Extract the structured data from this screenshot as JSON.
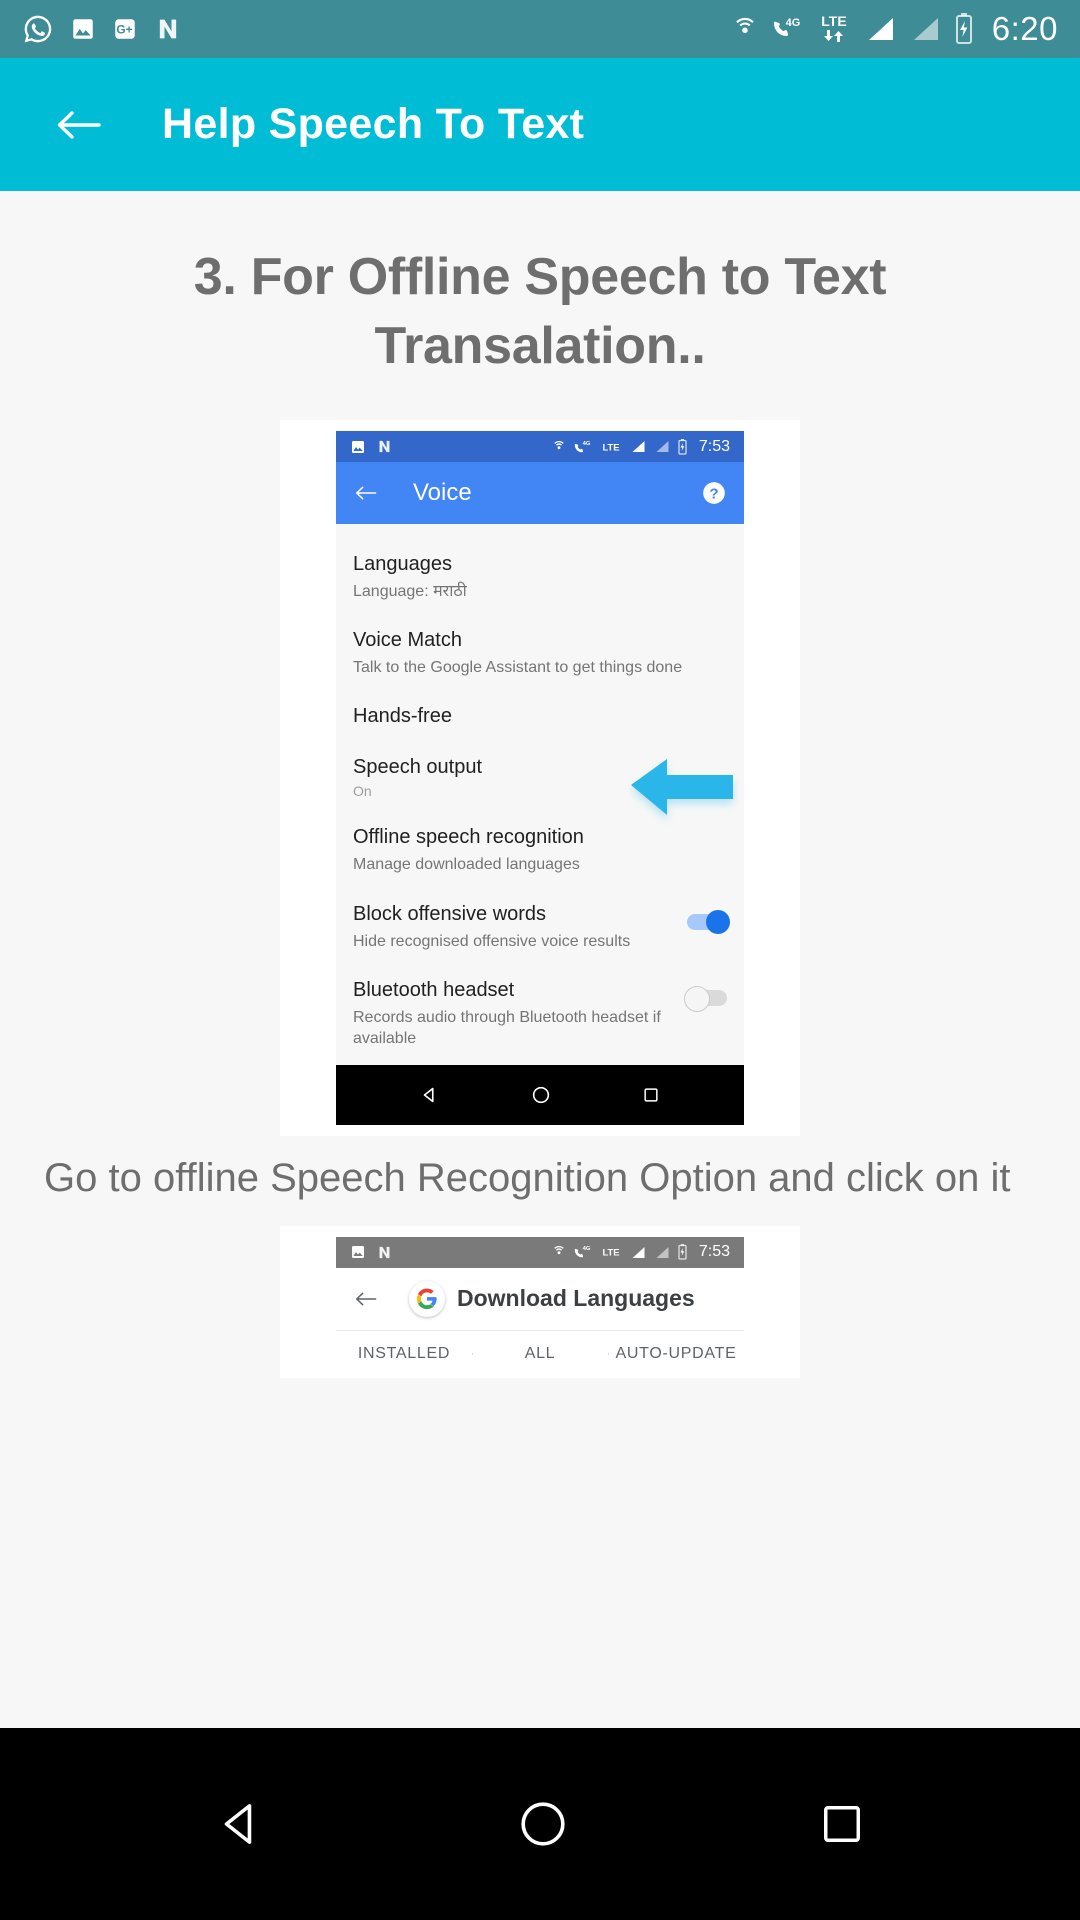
{
  "status_bar": {
    "icons": [
      "whatsapp-icon",
      "photos-icon",
      "google-plus-icon",
      "nova-launcher-icon"
    ],
    "network_icons": [
      "cast-icon",
      "4g-call-icon",
      "lte-data-icon",
      "signal-bar-icon",
      "signal-bar-2-icon",
      "battery-charging-icon"
    ],
    "network_4g_label": "4G",
    "network_lte_label": "LTE",
    "time": "6:20"
  },
  "app_bar": {
    "back_icon": "back-arrow-icon",
    "title": "Help Speech To Text"
  },
  "main": {
    "heading_line1": "3. For Offline Speech to Text",
    "heading_line2": "Transalation..",
    "caption": "Go to offline Speech Recognition Option and click on it"
  },
  "voice_screenshot": {
    "status_bar": {
      "icons": [
        "photos-icon",
        "nova-launcher-icon"
      ],
      "network_4g_label": "4G",
      "network_lte_label": "LTE",
      "time": "7:53"
    },
    "app_bar": {
      "back_icon": "back-arrow-icon",
      "title": "Voice",
      "help_icon": "help-circle-icon"
    },
    "settings": [
      {
        "title": "Languages",
        "subtitle": "Language: मराठी",
        "toggle": null
      },
      {
        "title": "Voice Match",
        "subtitle": "Talk to the Google Assistant to get things done",
        "toggle": null
      },
      {
        "title": "Hands-free",
        "subtitle": "",
        "toggle": null
      },
      {
        "title": "Speech output",
        "subtitle": "On",
        "toggle": null
      },
      {
        "title": "Offline speech recognition",
        "subtitle": "Manage downloaded languages",
        "toggle": null
      },
      {
        "title": "Block offensive words",
        "subtitle": "Hide recognised offensive voice results",
        "toggle": "on"
      },
      {
        "title": "Bluetooth headset",
        "subtitle": "Records audio through Bluetooth headset if available",
        "toggle": "off"
      }
    ],
    "annotation": {
      "icon": "left-pointing-arrow-icon",
      "color": "#29b6e8"
    },
    "nav_bar": {
      "back": "back-triangle-icon",
      "home": "home-circle-icon",
      "recents": "recents-square-icon"
    }
  },
  "download_screenshot": {
    "status_bar": {
      "icons": [
        "photos-icon",
        "nova-launcher-icon"
      ],
      "network_4g_label": "4G",
      "network_lte_label": "LTE",
      "time": "7:53"
    },
    "app_bar": {
      "back_icon": "back-arrow-icon",
      "logo_icon": "google-g-icon",
      "title": "Download Languages"
    },
    "tabs": [
      "INSTALLED",
      "ALL",
      "AUTO-UPDATE"
    ]
  },
  "nav_bar": {
    "back": "back-triangle-icon",
    "home": "home-circle-icon",
    "recents": "recents-square-icon"
  },
  "colors": {
    "app_bar": "#00bcd4",
    "status_bar": "#3d8c96",
    "inner_app_bar": "#4285f4",
    "annotation": "#29b6e8"
  }
}
